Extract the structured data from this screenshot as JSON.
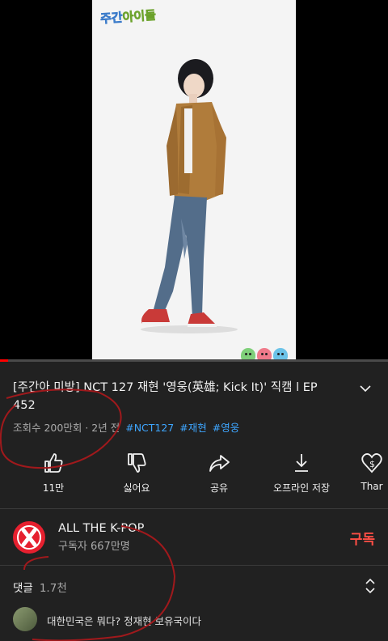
{
  "video": {
    "show_logo_left": "주간",
    "show_logo_right": "아이돌",
    "progress": 0.02
  },
  "info": {
    "title": "[주간아 미방] NCT 127 재현 '영웅(英雄; Kick It)' 직캠 l EP 452",
    "views": "조회수 200만회",
    "age": "2년 전",
    "separator": "·",
    "hashtags": [
      "#NCT127",
      "#재현",
      "#영웅"
    ]
  },
  "actions": [
    {
      "icon": "thumbs-up-icon",
      "label": "11만"
    },
    {
      "icon": "thumbs-down-icon",
      "label": "싫어요"
    },
    {
      "icon": "share-icon",
      "label": "공유"
    },
    {
      "icon": "download-icon",
      "label": "오프라인 저장"
    },
    {
      "icon": "thanks-icon",
      "label": "Thar"
    }
  ],
  "channel": {
    "name": "ALL THE K-POP",
    "subscribers": "구독자 667만명",
    "subscribe_label": "구독"
  },
  "comments": {
    "label": "댓글",
    "count": "1.7천",
    "first_comment": "대한민국은 뭐다? 정재현 보유국이다"
  },
  "colors": {
    "background": "#212121",
    "accent_red": "#ff4e45",
    "hashtag_blue": "#3ea6ff",
    "annotation_red": "#a0191c"
  }
}
